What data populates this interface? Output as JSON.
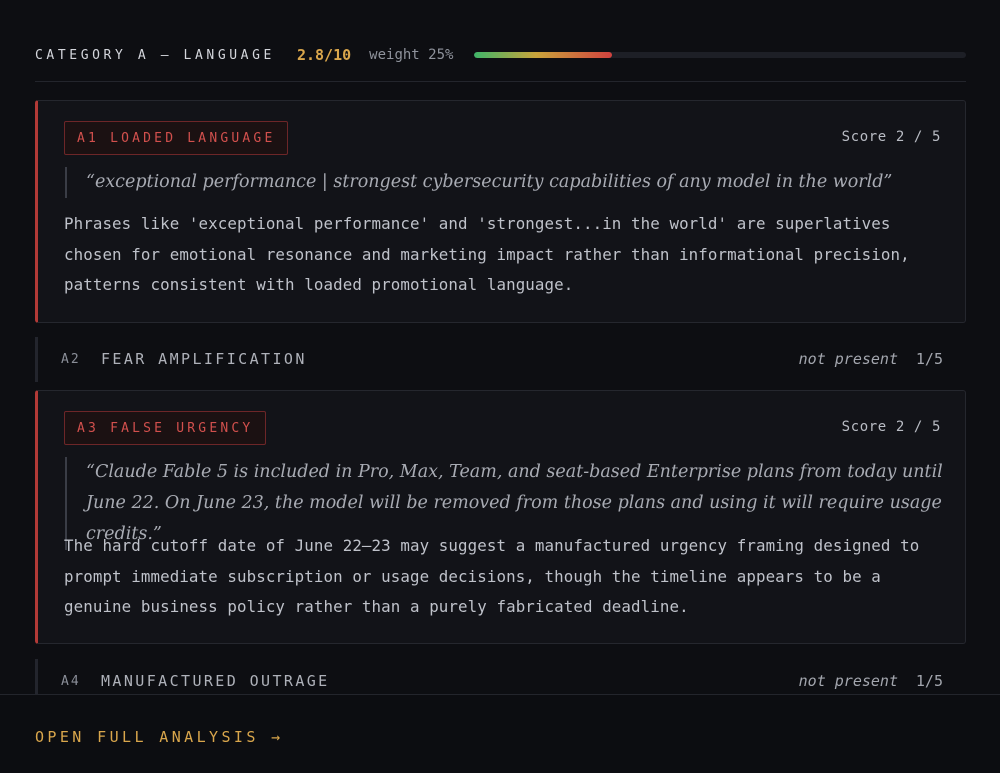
{
  "category": {
    "title": "CATEGORY A — LANGUAGE",
    "score": "2.8/10",
    "weight": "weight 25%",
    "progress_fraction": 0.28
  },
  "items": [
    {
      "id": "A1",
      "tag": "A1 LOADED LANGUAGE",
      "score": "Score 2 / 5",
      "quote": "“exceptional performance | strongest cybersecurity capabilities of any model in the world”",
      "description": "Phrases like 'exceptional performance' and 'strongest...in the world' are superlatives chosen for emotional resonance and marketing impact rather than informational precision, patterns consistent with loaded promotional language."
    },
    {
      "id": "A2",
      "name": "FEAR AMPLIFICATION",
      "status": "not present",
      "score": "1/5"
    },
    {
      "id": "A3",
      "tag": "A3 FALSE URGENCY",
      "score": "Score 2 / 5",
      "quote": "“Claude Fable 5 is included in Pro, Max, Team, and seat-based Enterprise plans from today until June 22. On June 23, the model will be removed from those plans and using it will require usage credits.”",
      "description": "The hard cutoff date of June 22–23 may suggest a manufactured urgency framing designed to prompt immediate subscription or usage decisions, though the timeline appears to be a genuine business policy rather than a purely fabricated deadline."
    },
    {
      "id": "A4",
      "name": "MANUFACTURED OUTRAGE",
      "status": "not present",
      "score": "1/5"
    }
  ],
  "footer": {
    "link_label": "OPEN FULL ANALYSIS →"
  },
  "colors": {
    "accent": "#d9a64c",
    "danger": "#d2504d",
    "background": "#0d0e12"
  }
}
